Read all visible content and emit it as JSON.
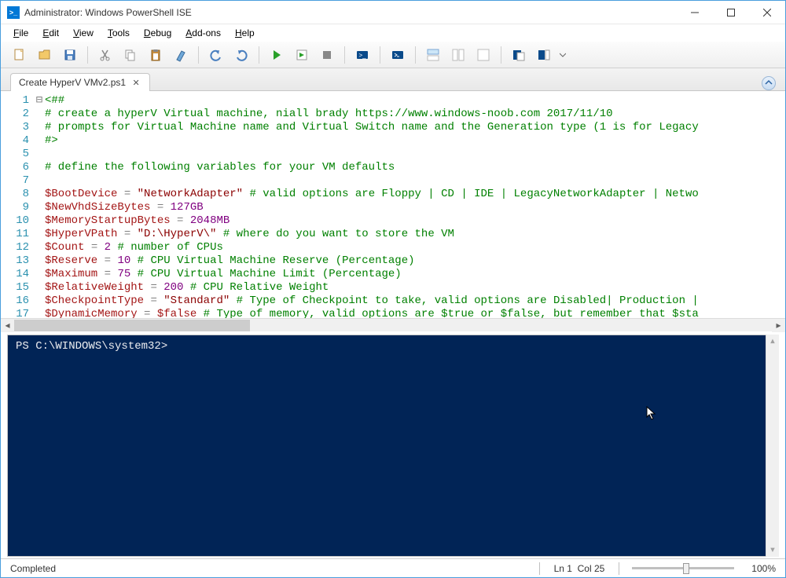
{
  "window": {
    "title": "Administrator: Windows PowerShell ISE"
  },
  "menu": [
    "File",
    "Edit",
    "View",
    "Tools",
    "Debug",
    "Add-ons",
    "Help"
  ],
  "menu_ul": [
    "F",
    "E",
    "V",
    "T",
    "D",
    "A",
    "H"
  ],
  "tab": {
    "name": "Create HyperV VMv2.ps1"
  },
  "code": {
    "lines": [
      {
        "n": 1,
        "tokens": [
          {
            "t": "<##",
            "c": "c-comment"
          }
        ]
      },
      {
        "n": 2,
        "tokens": [
          {
            "t": "# create a hyperV Virtual machine, niall brady https://www.windows-noob.com 2017/11/10",
            "c": "c-comment"
          }
        ]
      },
      {
        "n": 3,
        "tokens": [
          {
            "t": "# prompts for Virtual Machine name and Virtual Switch name and the Generation type (1 is for Legacy",
            "c": "c-comment"
          }
        ]
      },
      {
        "n": 4,
        "tokens": [
          {
            "t": "#>",
            "c": "c-comment"
          }
        ]
      },
      {
        "n": 5,
        "tokens": []
      },
      {
        "n": 6,
        "tokens": [
          {
            "t": "# define the following variables for your VM defaults",
            "c": "c-comment"
          }
        ]
      },
      {
        "n": 7,
        "tokens": []
      },
      {
        "n": 8,
        "tokens": [
          {
            "t": "$BootDevice",
            "c": "c-var"
          },
          {
            "t": " "
          },
          {
            "t": "=",
            "c": "c-op"
          },
          {
            "t": " "
          },
          {
            "t": "\"NetworkAdapter\"",
            "c": "c-str"
          },
          {
            "t": " "
          },
          {
            "t": "# valid options are Floppy | CD | IDE | LegacyNetworkAdapter | Netwo",
            "c": "c-comment"
          }
        ]
      },
      {
        "n": 9,
        "tokens": [
          {
            "t": "$NewVhdSizeBytes",
            "c": "c-var"
          },
          {
            "t": " "
          },
          {
            "t": "=",
            "c": "c-op"
          },
          {
            "t": " "
          },
          {
            "t": "127GB",
            "c": "c-num"
          }
        ]
      },
      {
        "n": 10,
        "tokens": [
          {
            "t": "$MemoryStartupBytes",
            "c": "c-var"
          },
          {
            "t": " "
          },
          {
            "t": "=",
            "c": "c-op"
          },
          {
            "t": " "
          },
          {
            "t": "2048MB",
            "c": "c-num"
          }
        ]
      },
      {
        "n": 11,
        "tokens": [
          {
            "t": "$HyperVPath",
            "c": "c-var"
          },
          {
            "t": " "
          },
          {
            "t": "=",
            "c": "c-op"
          },
          {
            "t": " "
          },
          {
            "t": "\"D:\\HyperV\\\"",
            "c": "c-str"
          },
          {
            "t": " "
          },
          {
            "t": "# where do you want to store the VM",
            "c": "c-comment"
          }
        ]
      },
      {
        "n": 12,
        "tokens": [
          {
            "t": "$Count",
            "c": "c-var"
          },
          {
            "t": " "
          },
          {
            "t": "=",
            "c": "c-op"
          },
          {
            "t": " "
          },
          {
            "t": "2",
            "c": "c-num"
          },
          {
            "t": " "
          },
          {
            "t": "# number of CPUs",
            "c": "c-comment"
          }
        ]
      },
      {
        "n": 13,
        "tokens": [
          {
            "t": "$Reserve",
            "c": "c-var"
          },
          {
            "t": " "
          },
          {
            "t": "=",
            "c": "c-op"
          },
          {
            "t": " "
          },
          {
            "t": "10",
            "c": "c-num"
          },
          {
            "t": " "
          },
          {
            "t": "# CPU Virtual Machine Reserve (Percentage)",
            "c": "c-comment"
          }
        ]
      },
      {
        "n": 14,
        "tokens": [
          {
            "t": "$Maximum",
            "c": "c-var"
          },
          {
            "t": " "
          },
          {
            "t": "=",
            "c": "c-op"
          },
          {
            "t": " "
          },
          {
            "t": "75",
            "c": "c-num"
          },
          {
            "t": " "
          },
          {
            "t": "# CPU Virtual Machine Limit (Percentage)",
            "c": "c-comment"
          }
        ]
      },
      {
        "n": 15,
        "tokens": [
          {
            "t": "$RelativeWeight",
            "c": "c-var"
          },
          {
            "t": " "
          },
          {
            "t": "=",
            "c": "c-op"
          },
          {
            "t": " "
          },
          {
            "t": "200",
            "c": "c-num"
          },
          {
            "t": " "
          },
          {
            "t": "# CPU Relative Weight",
            "c": "c-comment"
          }
        ]
      },
      {
        "n": 16,
        "tokens": [
          {
            "t": "$CheckpointType",
            "c": "c-var"
          },
          {
            "t": " "
          },
          {
            "t": "=",
            "c": "c-op"
          },
          {
            "t": " "
          },
          {
            "t": "\"Standard\"",
            "c": "c-str"
          },
          {
            "t": " "
          },
          {
            "t": "# Type of Checkpoint to take, valid options are Disabled| Production |",
            "c": "c-comment"
          }
        ]
      },
      {
        "n": 17,
        "tokens": [
          {
            "t": "$DynamicMemory",
            "c": "c-var"
          },
          {
            "t": " "
          },
          {
            "t": "=",
            "c": "c-op"
          },
          {
            "t": " "
          },
          {
            "t": "$false",
            "c": "c-var"
          },
          {
            "t": " "
          },
          {
            "t": "# Type of memory, valid options are $true or $false, but remember that $sta",
            "c": "c-comment"
          }
        ]
      }
    ]
  },
  "console": {
    "prompt": "PS C:\\WINDOWS\\system32> "
  },
  "status": {
    "text": "Completed",
    "pos_line": "Ln 1",
    "pos_col": "Col 25",
    "zoom": "100%"
  }
}
